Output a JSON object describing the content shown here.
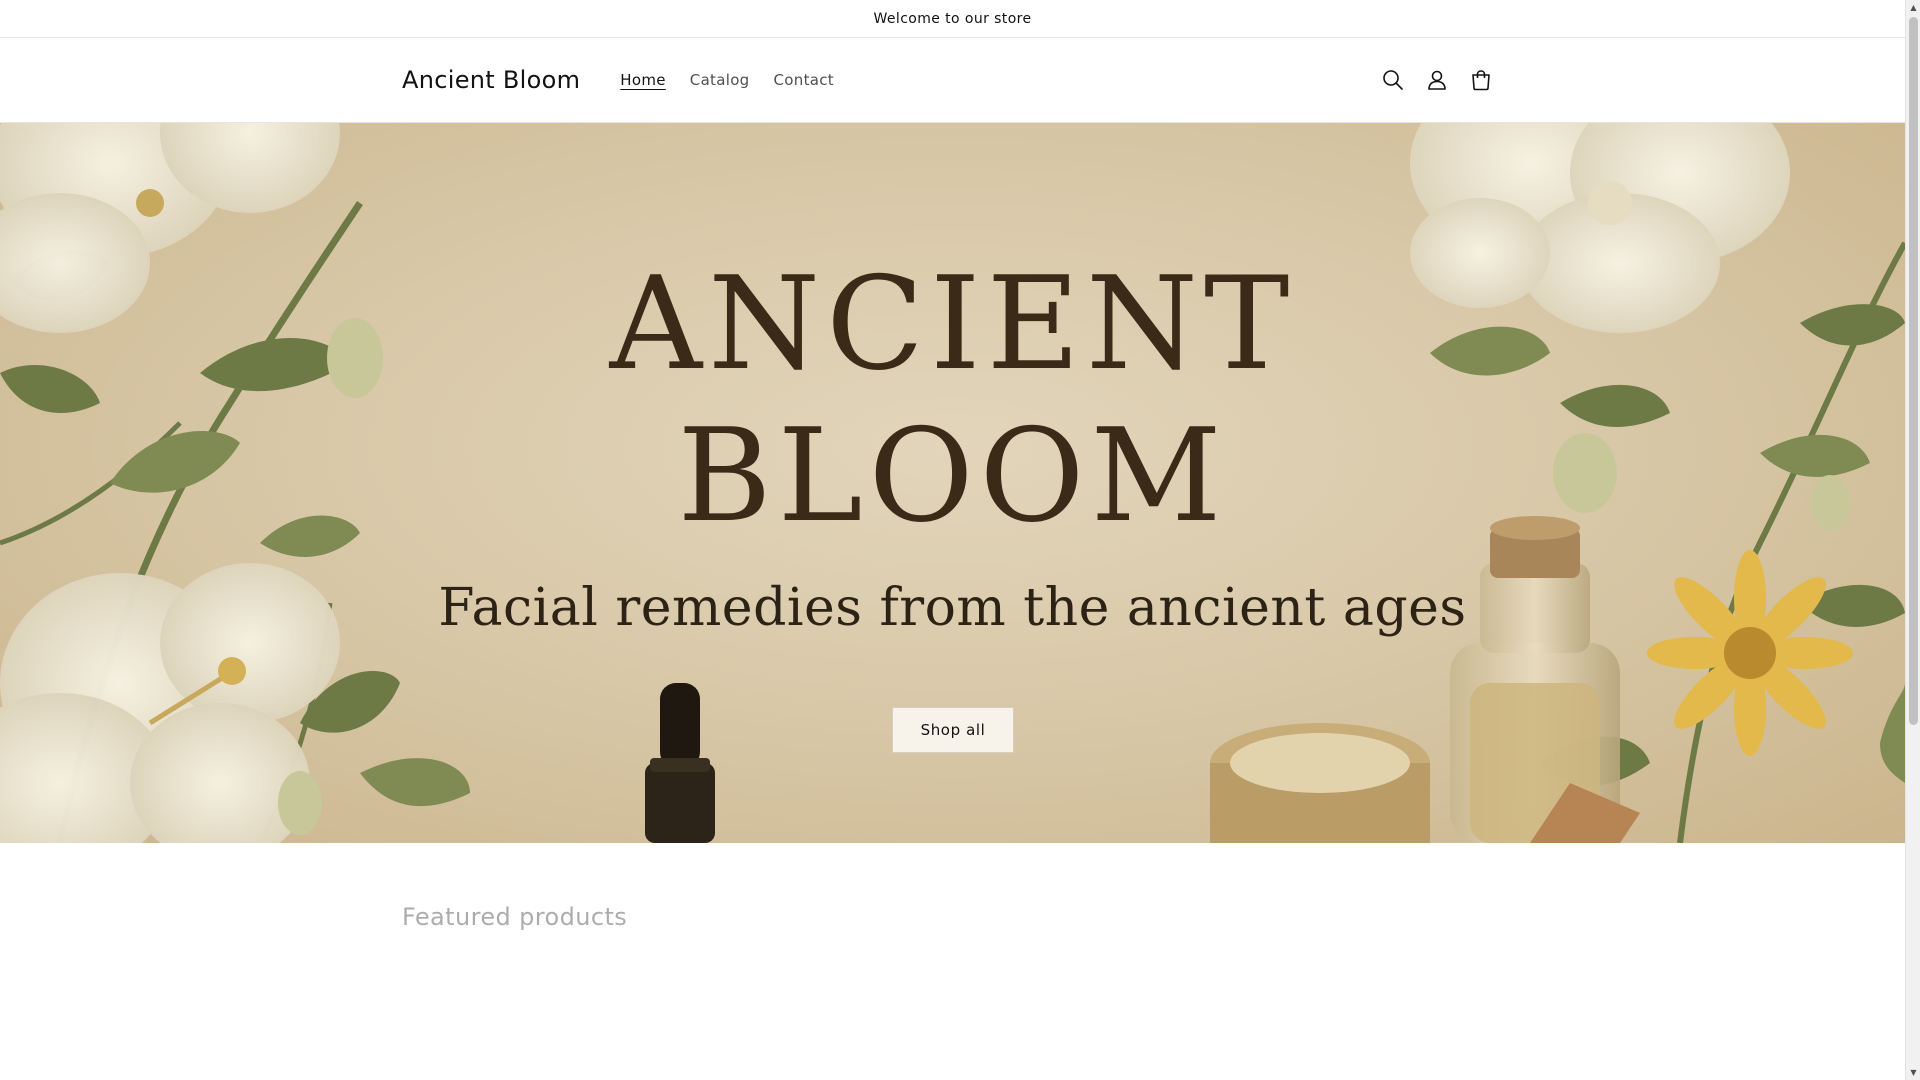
{
  "announcement": {
    "text": "Welcome to our store"
  },
  "header": {
    "logo": "Ancient Bloom",
    "nav": [
      {
        "label": "Home",
        "active": true
      },
      {
        "label": "Catalog",
        "active": false
      },
      {
        "label": "Contact",
        "active": false
      }
    ],
    "icons": [
      "search-icon",
      "account-icon",
      "cart-icon"
    ]
  },
  "hero": {
    "title_line1": "ANCIENT",
    "title_line2": "BLOOM",
    "subtitle": "Facial remedies from the ancient ages",
    "button_label": "Shop all"
  },
  "featured": {
    "title": "Featured products"
  },
  "colors": {
    "text": "#121212",
    "hero_text": "#3a2a17",
    "hero_bg": "#d9c9a9",
    "leaf": "#6d7a45",
    "flower": "#efe8d4"
  }
}
